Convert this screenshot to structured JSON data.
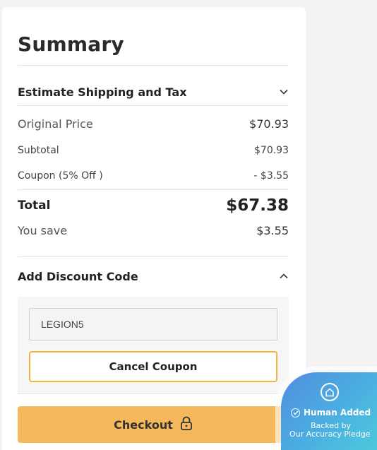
{
  "summary": {
    "title": "Summary",
    "shipping_label": "Estimate Shipping and Tax",
    "original_price_label": "Original Price",
    "original_price_value": "$70.93",
    "subtotal_label": "Subtotal",
    "subtotal_value": "$70.93",
    "coupon_label": "Coupon (5% Off )",
    "coupon_value": "- $3.55",
    "total_label": "Total",
    "total_value": "$67.38",
    "you_save_label": "You save",
    "you_save_value": "$3.55"
  },
  "discount": {
    "title": "Add Discount Code",
    "code_value": "LEGION5",
    "cancel_label": "Cancel Coupon"
  },
  "checkout": {
    "label": "Checkout",
    "icon": "lock-icon"
  },
  "badge": {
    "title": "Human Added",
    "line1": "Backed by",
    "line2": "Our Accuracy Pledge"
  },
  "colors": {
    "checkout_bg": "#f5b95c",
    "cancel_border": "#f4b23f",
    "badge_gradient_start": "#4f8de0",
    "badge_gradient_end": "#4fd1d9"
  }
}
